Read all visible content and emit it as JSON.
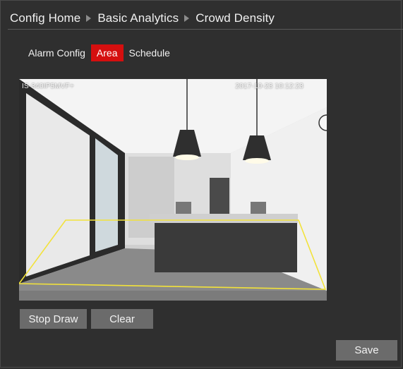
{
  "breadcrumb": {
    "items": [
      "Config Home",
      "Basic Analytics",
      "Crowd Density"
    ]
  },
  "tabs": [
    {
      "label": "Alarm Config",
      "active": false
    },
    {
      "label": "Area",
      "active": true
    },
    {
      "label": "Schedule",
      "active": false
    }
  ],
  "video": {
    "camera_name": "IS-340IP5MVF+",
    "timestamp": "2017-10-23   10:12:23",
    "area_color": "#f2e23a"
  },
  "buttons": {
    "stop_draw": "Stop Draw",
    "clear": "Clear",
    "save": "Save"
  },
  "colors": {
    "active_tab": "#d50f0f",
    "background": "#2f2f2f",
    "button": "#6b6b6b"
  }
}
